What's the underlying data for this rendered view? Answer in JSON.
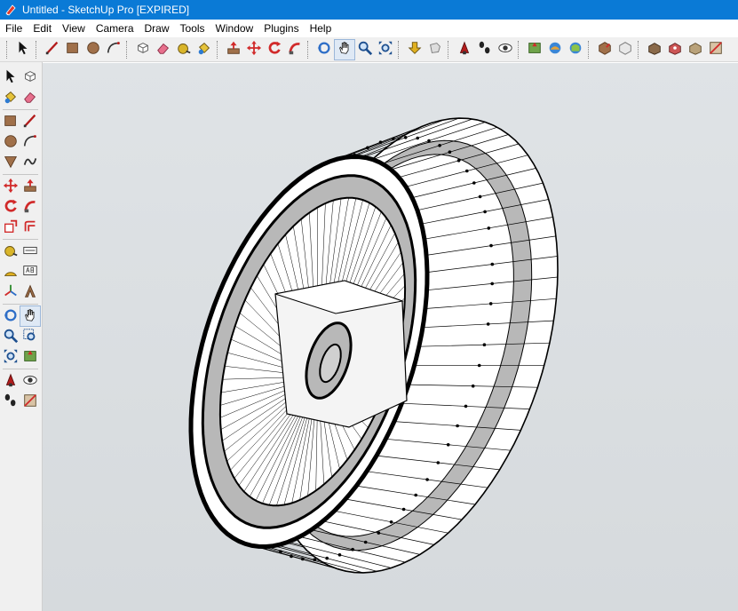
{
  "window": {
    "title": "Untitled - SketchUp Pro [EXPIRED]"
  },
  "menu": {
    "items": [
      "File",
      "Edit",
      "View",
      "Camera",
      "Draw",
      "Tools",
      "Window",
      "Plugins",
      "Help"
    ]
  },
  "toolbar": {
    "groups": [
      [
        "select-tool-icon"
      ],
      [
        "line-tool-icon",
        "rectangle-tool-icon",
        "circle-tool-icon",
        "arc-tool-icon"
      ],
      [
        "make-component-icon",
        "eraser-tool-icon",
        "tape-measure-icon",
        "paint-bucket-icon"
      ],
      [
        "push-pull-icon",
        "move-tool-icon",
        "rotate-tool-icon",
        "follow-me-icon"
      ],
      [
        "orbit-tool-icon",
        "pan-tool-icon",
        "zoom-tool-icon",
        "zoom-extents-icon"
      ],
      [
        "previous-view-icon",
        "next-view-icon"
      ],
      [
        "position-camera-icon",
        "walk-tool-icon",
        "look-around-icon"
      ],
      [
        "add-location-icon",
        "toggle-terrain-icon",
        "photo-textures-icon"
      ],
      [
        "get-models-icon",
        "share-model-icon"
      ],
      [
        "model-info-icon",
        "styles-icon",
        "sandbox-icon",
        "section-plane-icon"
      ]
    ],
    "active": "pan-tool-icon"
  },
  "sidebar": {
    "rows": [
      [
        "select-tool-icon",
        "make-component-icon"
      ],
      [
        "paint-bucket-icon",
        "eraser-tool-icon"
      ],
      [
        "rectangle-tool-icon",
        "line-tool-icon"
      ],
      [
        "circle-tool-icon",
        "arc-tool-icon"
      ],
      [
        "polygon-tool-icon",
        "freehand-tool-icon"
      ],
      [
        "move-tool-icon",
        "push-pull-icon"
      ],
      [
        "rotate-tool-icon",
        "follow-me-icon"
      ],
      [
        "scale-tool-icon",
        "offset-tool-icon"
      ],
      [
        "tape-measure-icon",
        "dimension-tool-icon"
      ],
      [
        "protractor-tool-icon",
        "text-tool-icon"
      ],
      [
        "axes-tool-icon",
        "3d-text-tool-icon"
      ],
      [
        "orbit-tool-icon",
        "pan-tool-icon"
      ],
      [
        "zoom-tool-icon",
        "zoom-window-icon"
      ],
      [
        "zoom-extents-icon",
        "add-location-icon"
      ],
      [
        "position-camera-icon",
        "look-around-icon"
      ],
      [
        "walk-tool-icon",
        "section-plane-icon"
      ]
    ],
    "active": "pan-tool-icon"
  },
  "colors": {
    "titlebar": "#0a7ad6",
    "viewport_bg": "#dadee1",
    "model_edge": "#000000",
    "model_face": "#ffffff",
    "model_shade": "#b8b8b8"
  }
}
